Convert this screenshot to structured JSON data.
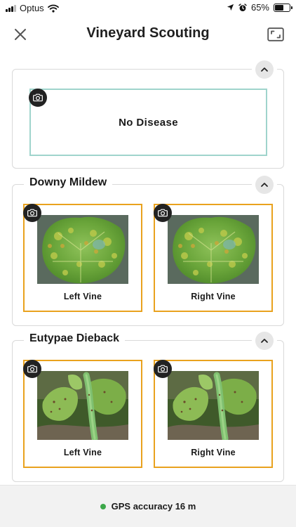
{
  "status_bar": {
    "carrier": "Optus",
    "battery_percent": "65%",
    "battery_level": 0.65,
    "icons": [
      "signal-icon",
      "wifi-icon",
      "location-arrow-icon",
      "alarm-icon",
      "battery-icon"
    ]
  },
  "nav": {
    "title": "Vineyard Scouting",
    "close_icon": "close-icon",
    "expand_icon": "expand-icon"
  },
  "sections": [
    {
      "title": "",
      "cards": [
        {
          "label": "No Disease",
          "icon": "camera-icon"
        }
      ]
    },
    {
      "title": "Downy Mildew",
      "cards": [
        {
          "label": "Left Vine",
          "icon": "camera-icon",
          "photo": "downy-mildew-leaf"
        },
        {
          "label": "Right Vine",
          "icon": "camera-icon",
          "photo": "downy-mildew-leaf"
        }
      ]
    },
    {
      "title": "Eutypae Dieback",
      "cards": [
        {
          "label": "Left Vine",
          "icon": "camera-icon",
          "photo": "eutypa-shoot"
        },
        {
          "label": "Right Vine",
          "icon": "camera-icon",
          "photo": "eutypa-shoot"
        }
      ]
    }
  ],
  "footer": {
    "gps_text": "GPS accuracy 16 m",
    "gps_status_color": "#3da84a"
  },
  "colors": {
    "accent_orange": "#e9a21e",
    "accent_teal": "#9fd4cc"
  }
}
